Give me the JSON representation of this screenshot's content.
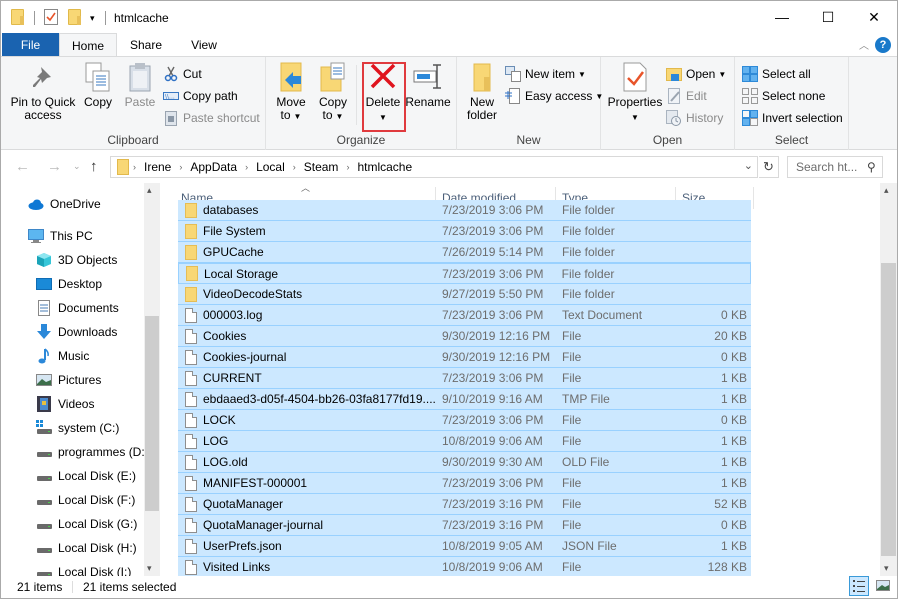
{
  "window": {
    "title": "htmlcache",
    "controls": {
      "minimize": "—",
      "maximize": "☐",
      "close": "✕"
    },
    "help": "?"
  },
  "tabs": [
    {
      "label": "File",
      "active": false
    },
    {
      "label": "Home",
      "active": true
    },
    {
      "label": "Share",
      "active": false
    },
    {
      "label": "View",
      "active": false
    }
  ],
  "ribbon": {
    "clipboard": {
      "label": "Clipboard",
      "pin": "Pin to Quick access",
      "pin_l1": "Pin to Quick",
      "pin_l2": "access",
      "copy": "Copy",
      "paste": "Paste",
      "cut": "Cut",
      "copy_path": "Copy path",
      "paste_shortcut": "Paste shortcut"
    },
    "organize": {
      "label": "Organize",
      "move_l1": "Move",
      "move_l2": "to",
      "copy_l1": "Copy",
      "copy_l2": "to",
      "delete": "Delete",
      "rename": "Rename"
    },
    "new": {
      "label": "New",
      "new_folder_l1": "New",
      "new_folder_l2": "folder",
      "new_item": "New item",
      "easy_access": "Easy access"
    },
    "open": {
      "label": "Open",
      "properties": "Properties",
      "open": "Open",
      "edit": "Edit",
      "history": "History"
    },
    "select": {
      "label": "Select",
      "select_all": "Select all",
      "select_none": "Select none",
      "invert": "Invert selection"
    },
    "highlight_color": "#e03a3e"
  },
  "address": {
    "crumbs": [
      "Irene",
      "AppData",
      "Local",
      "Steam",
      "htmlcache"
    ],
    "search_placeholder": "Search ht..."
  },
  "nav_pane": [
    {
      "label": "OneDrive",
      "icon": "onedrive-icon"
    },
    {
      "label": "This PC",
      "icon": "pc-icon"
    },
    {
      "label": "3D Objects",
      "icon": "3d-objects-icon"
    },
    {
      "label": "Desktop",
      "icon": "desktop-icon"
    },
    {
      "label": "Documents",
      "icon": "documents-icon"
    },
    {
      "label": "Downloads",
      "icon": "downloads-icon"
    },
    {
      "label": "Music",
      "icon": "music-icon"
    },
    {
      "label": "Pictures",
      "icon": "pictures-icon"
    },
    {
      "label": "Videos",
      "icon": "videos-icon"
    },
    {
      "label": "system (C:)",
      "icon": "drive-icon"
    },
    {
      "label": "programmes (D:",
      "icon": "drive-icon"
    },
    {
      "label": "Local Disk (E:)",
      "icon": "drive-icon"
    },
    {
      "label": "Local Disk (F:)",
      "icon": "drive-icon"
    },
    {
      "label": "Local Disk (G:)",
      "icon": "drive-icon"
    },
    {
      "label": "Local Disk (H:)",
      "icon": "drive-icon"
    },
    {
      "label": "Local Disk (I:)",
      "icon": "drive-icon"
    }
  ],
  "columns": {
    "name": "Name",
    "date": "Date modified",
    "type": "Type",
    "size": "Size"
  },
  "files": [
    {
      "name": "databases",
      "date": "7/23/2019 3:06 PM",
      "type": "File folder",
      "size": "",
      "kind": "folder"
    },
    {
      "name": "File System",
      "date": "7/23/2019 3:06 PM",
      "type": "File folder",
      "size": "",
      "kind": "folder"
    },
    {
      "name": "GPUCache",
      "date": "7/26/2019 5:14 PM",
      "type": "File folder",
      "size": "",
      "kind": "folder"
    },
    {
      "name": "Local Storage",
      "date": "7/23/2019 3:06 PM",
      "type": "File folder",
      "size": "",
      "kind": "folder"
    },
    {
      "name": "VideoDecodeStats",
      "date": "9/27/2019 5:50 PM",
      "type": "File folder",
      "size": "",
      "kind": "folder"
    },
    {
      "name": "000003.log",
      "date": "7/23/2019 3:06 PM",
      "type": "Text Document",
      "size": "0 KB",
      "kind": "text"
    },
    {
      "name": "Cookies",
      "date": "9/30/2019 12:16 PM",
      "type": "File",
      "size": "20 KB",
      "kind": "file"
    },
    {
      "name": "Cookies-journal",
      "date": "9/30/2019 12:16 PM",
      "type": "File",
      "size": "0 KB",
      "kind": "file"
    },
    {
      "name": "CURRENT",
      "date": "7/23/2019 3:06 PM",
      "type": "File",
      "size": "1 KB",
      "kind": "file"
    },
    {
      "name": "ebdaaed3-d05f-4504-bb26-03fa8177fd19....",
      "date": "9/10/2019 9:16 AM",
      "type": "TMP File",
      "size": "1 KB",
      "kind": "file"
    },
    {
      "name": "LOCK",
      "date": "7/23/2019 3:06 PM",
      "type": "File",
      "size": "0 KB",
      "kind": "file"
    },
    {
      "name": "LOG",
      "date": "10/8/2019 9:06 AM",
      "type": "File",
      "size": "1 KB",
      "kind": "file"
    },
    {
      "name": "LOG.old",
      "date": "9/30/2019 9:30 AM",
      "type": "OLD File",
      "size": "1 KB",
      "kind": "file"
    },
    {
      "name": "MANIFEST-000001",
      "date": "7/23/2019 3:06 PM",
      "type": "File",
      "size": "1 KB",
      "kind": "file"
    },
    {
      "name": "QuotaManager",
      "date": "7/23/2019 3:16 PM",
      "type": "File",
      "size": "52 KB",
      "kind": "file"
    },
    {
      "name": "QuotaManager-journal",
      "date": "7/23/2019 3:16 PM",
      "type": "File",
      "size": "0 KB",
      "kind": "file"
    },
    {
      "name": "UserPrefs.json",
      "date": "10/8/2019 9:05 AM",
      "type": "JSON File",
      "size": "1 KB",
      "kind": "file"
    },
    {
      "name": "Visited Links",
      "date": "10/8/2019 9:06 AM",
      "type": "File",
      "size": "128 KB",
      "kind": "file"
    }
  ],
  "status": {
    "items": "21 items",
    "selected": "21 items selected"
  }
}
